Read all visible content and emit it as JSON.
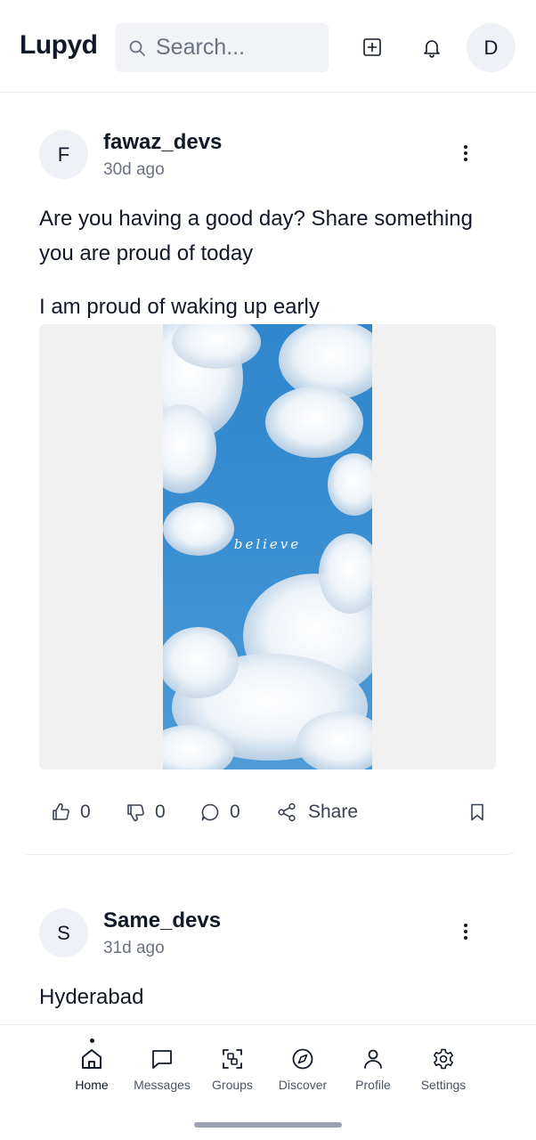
{
  "header": {
    "logo": "Lupyd",
    "search_placeholder": "Search...",
    "icons": [
      "search-icon",
      "add-post-icon",
      "bell-icon"
    ],
    "user_initial": "D"
  },
  "posts": [
    {
      "initial": "F",
      "username": "fawaz_devs",
      "time": "30d ago",
      "text": "Are you having a good day? Share something you are proud of today",
      "text2": "I am proud of waking up early",
      "image_caption": "believe",
      "likes": "0",
      "dislikes": "0",
      "comments": "0",
      "share_label": "Share"
    },
    {
      "initial": "S",
      "username": "Same_devs",
      "time": "31d ago",
      "text": "Hyderabad"
    }
  ],
  "nav": {
    "items": [
      {
        "label": "Home",
        "icon": "home-icon",
        "active": true
      },
      {
        "label": "Messages",
        "icon": "message-icon"
      },
      {
        "label": "Groups",
        "icon": "groups-icon"
      },
      {
        "label": "Discover",
        "icon": "compass-icon"
      },
      {
        "label": "Profile",
        "icon": "user-icon"
      },
      {
        "label": "Settings",
        "icon": "gear-icon"
      }
    ]
  },
  "colors": {
    "text": "#111827",
    "muted": "#6b7280",
    "surface": "#f1f3f6",
    "sky": "#2f86cc"
  }
}
